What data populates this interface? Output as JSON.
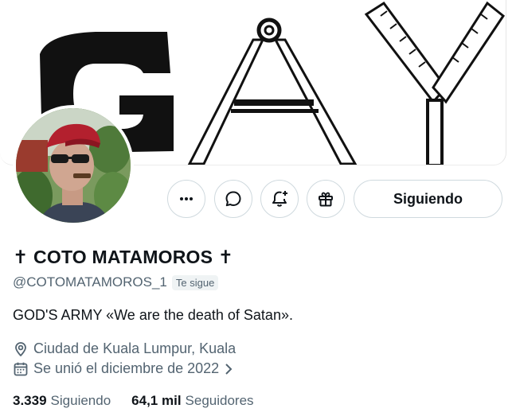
{
  "banner": {
    "text": "GAY"
  },
  "actions": {
    "follow_label": "Siguiendo",
    "more_icon": "more-horizontal-icon",
    "message_icon": "message-bubble-icon",
    "notify_icon": "bell-plus-icon",
    "gift_icon": "gift-icon"
  },
  "profile": {
    "display_name": "✝ COTO MATAMOROS ✝",
    "handle": "@COTOMATAMOROS_1",
    "follows_you": "Te sigue",
    "bio": "GOD'S ARMY «We are the death of Satan».",
    "location": "Ciudad de Kuala Lumpur, Kuala",
    "joined": "Se unió el diciembre de 2022"
  },
  "stats": {
    "following_count": "3.339",
    "following_label": "Siguiendo",
    "followers_count": "64,1 mil",
    "followers_label": "Seguidores"
  },
  "colors": {
    "text_primary": "#0f1419",
    "text_secondary": "#536471",
    "border": "#cfd9de",
    "badge_bg": "#eff3f4"
  }
}
